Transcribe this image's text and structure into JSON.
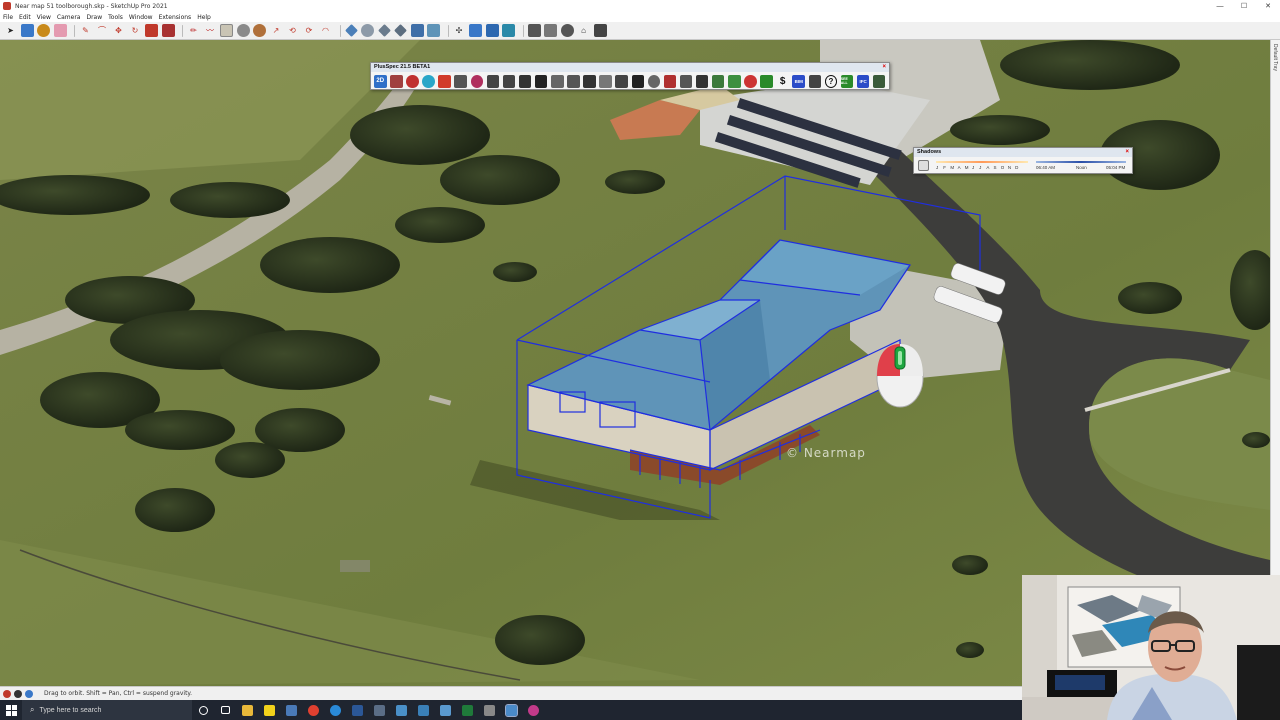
{
  "window": {
    "title": "Near map 51 toolborough.skp - SketchUp Pro 2021",
    "controls": [
      "—",
      "☐",
      "✕"
    ]
  },
  "menu": [
    "File",
    "Edit",
    "View",
    "Camera",
    "Draw",
    "Tools",
    "Window",
    "Extensions",
    "Help"
  ],
  "tray_label": "Default Tray",
  "plusspec": {
    "title": "PlusSpec 21.5 BETA1",
    "close": "×",
    "tool_2d": "2D",
    "tool_dollar": "$",
    "tool_bim": "BIM",
    "tool_help": "?",
    "tool_see_all": "SEE ALL",
    "tool_ifc": "IFC"
  },
  "shadows": {
    "title": "Shadows",
    "close": "×",
    "months": [
      "J",
      "F",
      "M",
      "A",
      "M",
      "J",
      "J",
      "A",
      "S",
      "O",
      "N",
      "D"
    ],
    "time_start": "06:40 AM",
    "noon": "Noon",
    "time_end": "05:04 PM"
  },
  "watermark": "© Nearmap",
  "status": {
    "hint": "Drag to orbit. Shift = Pan, Ctrl = suspend gravity."
  },
  "taskbar": {
    "search_placeholder": "Type here to search"
  },
  "colors": {
    "selection": "#1f2ee0",
    "roof": "#5f94b8",
    "asphalt": "#3b3b3b",
    "grass": "#7c8a4c",
    "taskbar": "#1f2530"
  }
}
